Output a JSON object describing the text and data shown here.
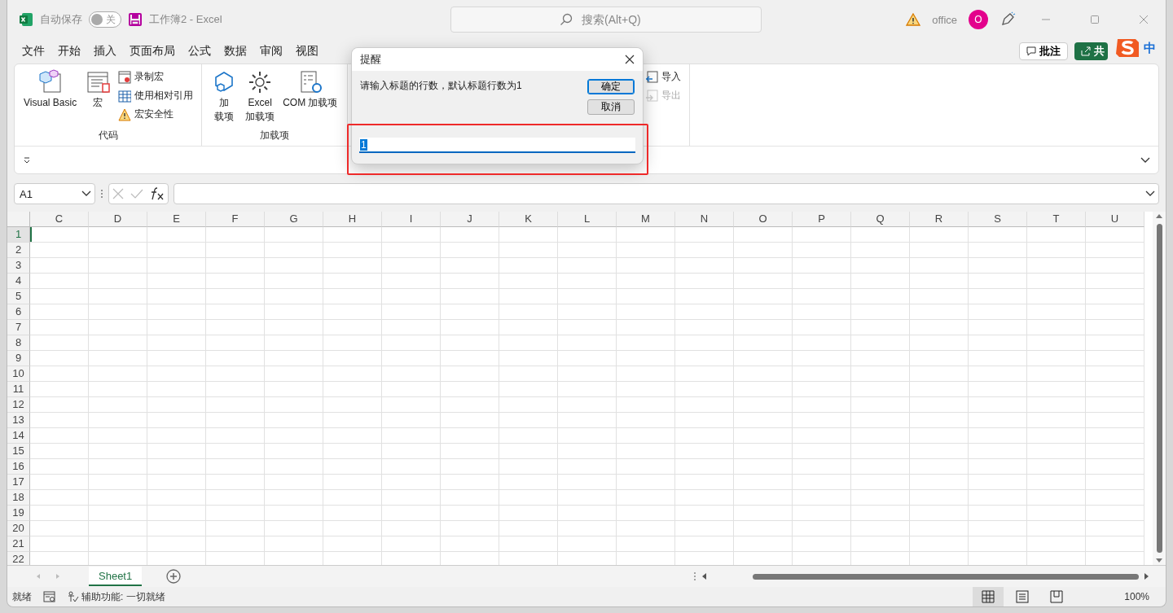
{
  "title_bar": {
    "autosave_label": "自动保存",
    "autosave_toggle": {
      "label": "关",
      "on": false
    },
    "document_title": "工作簿2  -  Excel",
    "search": {
      "placeholder": "搜索(Alt+Q)"
    },
    "account_name": "office",
    "avatar": "O"
  },
  "menu_tabs": [
    "文件",
    "开始",
    "插入",
    "页面布局",
    "公式",
    "数据",
    "审阅",
    "视图"
  ],
  "comment_button": "批注",
  "share_button": "共",
  "ime_indicator": "中",
  "ribbon": {
    "groups": [
      {
        "label": "代码",
        "items": [
          {
            "kind": "large",
            "lines": [
              "Visual Basic"
            ],
            "disabled": false
          },
          {
            "kind": "large",
            "lines": [
              "宏"
            ],
            "disabled": false
          },
          {
            "kind": "small",
            "label": "录制宏",
            "disabled": false
          },
          {
            "kind": "small",
            "label": "使用相对引用",
            "disabled": false
          },
          {
            "kind": "small",
            "label": "宏安全性",
            "disabled": false
          }
        ]
      },
      {
        "label": "加载项",
        "items": [
          {
            "kind": "large",
            "lines": [
              "加",
              "载项"
            ],
            "disabled": false
          },
          {
            "kind": "large",
            "lines": [
              "Excel",
              "加载项"
            ],
            "disabled": false
          },
          {
            "kind": "large",
            "lines": [
              "COM 加载项"
            ],
            "disabled": false
          }
        ]
      },
      {
        "items": [
          {
            "kind": "small",
            "label": "导入",
            "disabled": false
          },
          {
            "kind": "small",
            "label": "导出",
            "disabled": true
          }
        ]
      }
    ]
  },
  "formula_bar": {
    "name_box": "A1"
  },
  "sheet": {
    "columns": [
      "C",
      "D",
      "E",
      "F",
      "G",
      "H",
      "I",
      "J",
      "K",
      "L",
      "M",
      "N",
      "O",
      "P",
      "Q",
      "R",
      "S",
      "T",
      "U"
    ],
    "rows": [
      {
        "label": "1",
        "selected": true
      },
      {
        "label": "2",
        "selected": false
      },
      {
        "label": "3",
        "selected": false
      },
      {
        "label": "4",
        "selected": false
      },
      {
        "label": "5",
        "selected": false
      },
      {
        "label": "6",
        "selected": false
      },
      {
        "label": "7",
        "selected": false
      },
      {
        "label": "8",
        "selected": false
      },
      {
        "label": "9",
        "selected": false
      },
      {
        "label": "10",
        "selected": false
      },
      {
        "label": "11",
        "selected": false
      },
      {
        "label": "12",
        "selected": false
      },
      {
        "label": "13",
        "selected": false
      },
      {
        "label": "14",
        "selected": false
      },
      {
        "label": "15",
        "selected": false
      },
      {
        "label": "16",
        "selected": false
      },
      {
        "label": "17",
        "selected": false
      },
      {
        "label": "18",
        "selected": false
      },
      {
        "label": "19",
        "selected": false
      },
      {
        "label": "20",
        "selected": false
      },
      {
        "label": "21",
        "selected": false
      },
      {
        "label": "22",
        "selected": false
      }
    ]
  },
  "sheet_tabs": [
    {
      "label": "Sheet1",
      "selected": true
    }
  ],
  "status_bar": {
    "status": "就绪",
    "accessibility": "辅助功能: 一切就绪",
    "view_modes": [
      {
        "selected": true
      },
      {
        "selected": false
      },
      {
        "selected": false
      }
    ],
    "zoom": "100%"
  },
  "dialog": {
    "title": "提醒",
    "message": "请输入标题的行数，默认标题行数为1",
    "buttons": [
      {
        "label": "确定",
        "default": true
      },
      {
        "label": "取消",
        "default": false
      }
    ],
    "input": {
      "value": "1"
    }
  }
}
